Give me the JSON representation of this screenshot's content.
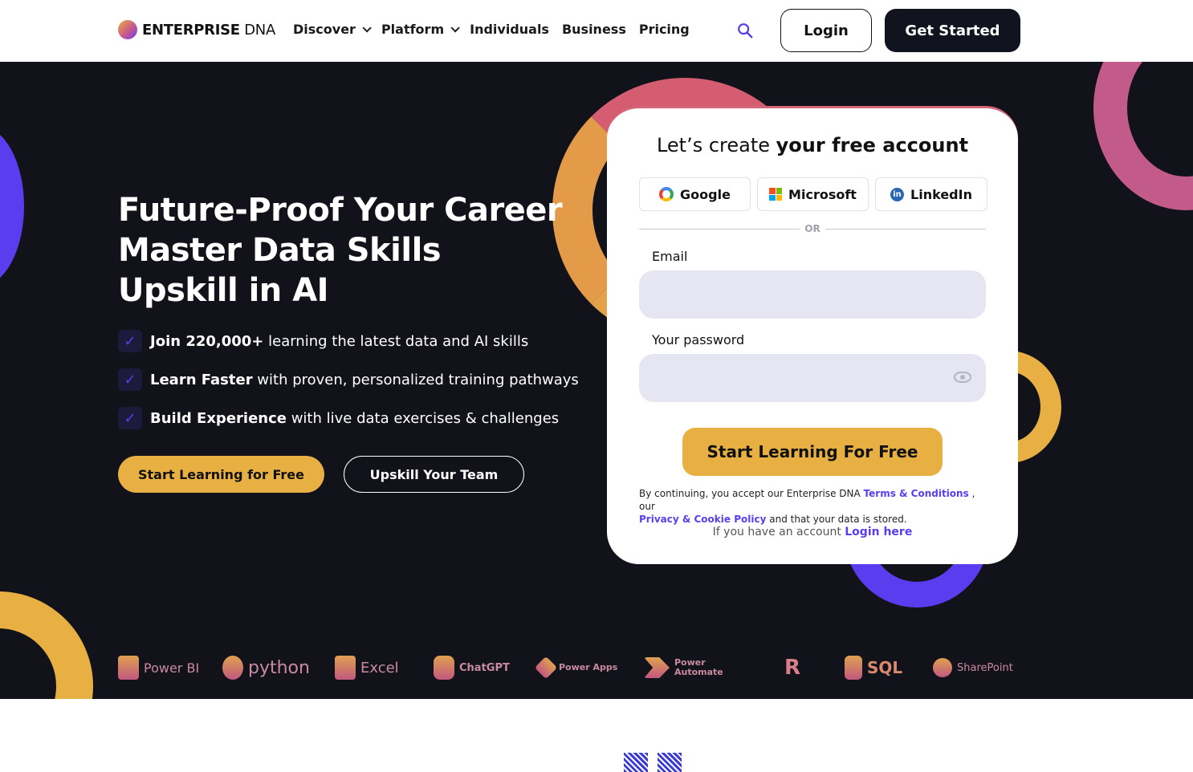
{
  "brand": {
    "name_bold": "ENTERPRISE",
    "name_light": " DNA"
  },
  "nav": {
    "links": [
      {
        "label": "Discover",
        "has_dropdown": true
      },
      {
        "label": "Platform",
        "has_dropdown": true
      },
      {
        "label": "Individuals",
        "has_dropdown": false
      },
      {
        "label": "Business",
        "has_dropdown": false
      },
      {
        "label": "Pricing",
        "has_dropdown": false
      }
    ],
    "login": "Login",
    "get_started": "Get Started"
  },
  "hero": {
    "title_lines": [
      "Future-Proof Your Career",
      "Master Data Skills",
      "Upskill in AI"
    ],
    "bullets": [
      {
        "bold": "Join 220,000+",
        "text": " learning the latest data and AI skills"
      },
      {
        "bold": "Learn Faster",
        "text": " with proven, personalized training pathways"
      },
      {
        "bold": "Build Experience",
        "text": " with live data exercises & challenges"
      }
    ],
    "cta_primary": "Start Learning for Free",
    "cta_secondary": "Upskill Your Team"
  },
  "signup": {
    "title_regular": "Let’s create ",
    "title_bold": "your free account",
    "social": {
      "google": "Google",
      "microsoft": "Microsoft",
      "linkedin": "LinkedIn"
    },
    "or": "OR",
    "email_label": "Email",
    "email_value": "",
    "password_label": "Your password",
    "password_value": "",
    "submit": "Start Learning For Free",
    "legal_prefix": "By continuing, you accept our Enterprise DNA ",
    "terms_link": "Terms & Conditions",
    "legal_mid": " , our",
    "privacy_link": "Privacy & Cookie Policy",
    "legal_suffix": " and that your data is stored.",
    "have_account": "If you have an account ",
    "login_here": "Login here"
  },
  "tools": [
    "Power BI",
    "python",
    "Excel",
    "ChatGPT",
    "Power Apps",
    "Power Automate",
    "R",
    "SQL",
    "SharePoint"
  ],
  "colors": {
    "accent_gold": "#e8b043",
    "accent_purple": "#5b3df0",
    "accent_pink": "#c25a8a",
    "hero_bg": "#12121b"
  }
}
